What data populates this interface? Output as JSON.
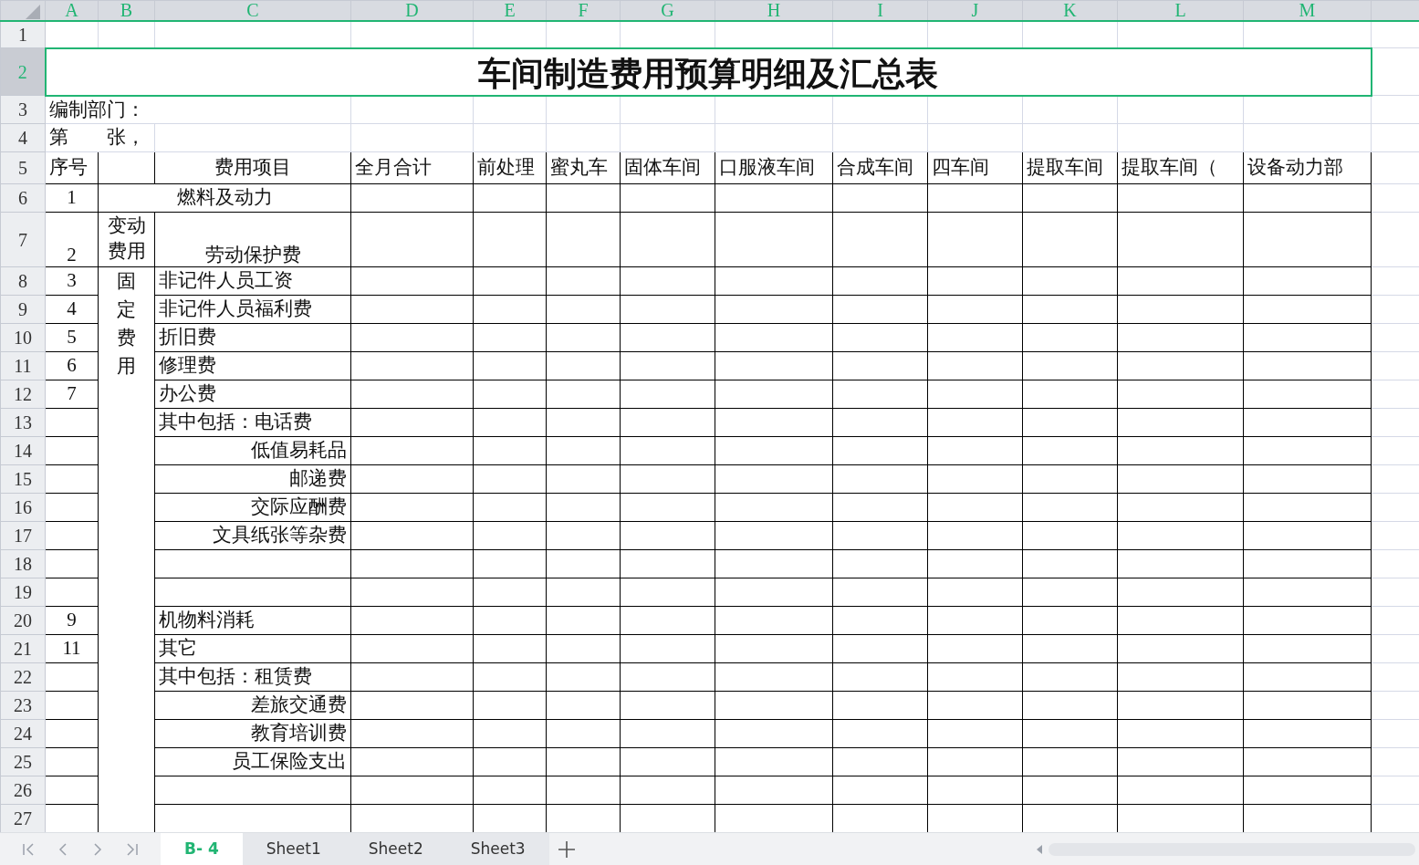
{
  "column_headers": [
    {
      "label": "A",
      "selected": true
    },
    {
      "label": "B",
      "selected": true
    },
    {
      "label": "C",
      "selected": true
    },
    {
      "label": "D",
      "selected": true
    },
    {
      "label": "E",
      "selected": true
    },
    {
      "label": "F",
      "selected": true
    },
    {
      "label": "G",
      "selected": true
    },
    {
      "label": "H",
      "selected": true
    },
    {
      "label": "I",
      "selected": true
    },
    {
      "label": "J",
      "selected": true
    },
    {
      "label": "K",
      "selected": true
    },
    {
      "label": "L",
      "selected": true
    },
    {
      "label": "M",
      "selected": true
    }
  ],
  "row_numbers": [
    {
      "label": "1",
      "selected": false
    },
    {
      "label": "2",
      "selected": true
    },
    {
      "label": "3",
      "selected": false
    },
    {
      "label": "4",
      "selected": false
    },
    {
      "label": "5",
      "selected": false
    },
    {
      "label": "6",
      "selected": false
    },
    {
      "label": "7",
      "selected": false
    },
    {
      "label": "8",
      "selected": false
    },
    {
      "label": "9",
      "selected": false
    },
    {
      "label": "10",
      "selected": false
    },
    {
      "label": "11",
      "selected": false
    },
    {
      "label": "12",
      "selected": false
    },
    {
      "label": "13",
      "selected": false
    },
    {
      "label": "14",
      "selected": false
    },
    {
      "label": "15",
      "selected": false
    },
    {
      "label": "16",
      "selected": false
    },
    {
      "label": "17",
      "selected": false
    },
    {
      "label": "18",
      "selected": false
    },
    {
      "label": "19",
      "selected": false
    },
    {
      "label": "20",
      "selected": false
    },
    {
      "label": "21",
      "selected": false
    },
    {
      "label": "22",
      "selected": false
    },
    {
      "label": "23",
      "selected": false
    },
    {
      "label": "24",
      "selected": false
    },
    {
      "label": "25",
      "selected": false
    },
    {
      "label": "26",
      "selected": false
    },
    {
      "label": "27",
      "selected": false
    }
  ],
  "title": "车间制造费用预算明细及汇总表",
  "department_label": "编制部门：",
  "page_label": "第　　张，",
  "header_row": {
    "seq": "序号",
    "item": "费用项目",
    "columns": [
      "全月合计",
      "前处理",
      "蜜丸车",
      "固体车间",
      "口服液车间",
      "合成车间",
      "四车间",
      "提取车间",
      "提取车间（",
      "设备动力部"
    ]
  },
  "variable_cost_label": "变动费用",
  "fixed_cost_label": "固定费用",
  "rows": [
    {
      "seq": "1",
      "item": "燃料及动力",
      "kind": "main"
    },
    {
      "seq": "2",
      "item": "劳动保护费",
      "kind": "variable"
    },
    {
      "seq": "3",
      "item": "非记件人员工资",
      "kind": "fixed"
    },
    {
      "seq": "4",
      "item": "非记件人员福利费",
      "kind": "fixed"
    },
    {
      "seq": "5",
      "item": "折旧费",
      "kind": "fixed"
    },
    {
      "seq": "6",
      "item": "修理费",
      "kind": "fixed"
    },
    {
      "seq": "7",
      "item": "办公费",
      "kind": "fixed"
    },
    {
      "item": "其中包括：电话费",
      "kind": "fixed"
    },
    {
      "item": "低值易耗品",
      "kind": "sub"
    },
    {
      "item": "邮递费",
      "kind": "sub"
    },
    {
      "item": "交际应酬费",
      "kind": "sub"
    },
    {
      "item": "文具纸张等杂费",
      "kind": "sub"
    },
    {
      "kind": "blank"
    },
    {
      "kind": "blank"
    },
    {
      "seq": "9",
      "item": "机物料消耗",
      "kind": "fixed"
    },
    {
      "seq": "11",
      "item": "其它",
      "kind": "fixed"
    },
    {
      "item": "其中包括：租赁费",
      "kind": "fixed"
    },
    {
      "item": "差旅交通费",
      "kind": "sub"
    },
    {
      "item": "教育培训费",
      "kind": "sub"
    },
    {
      "item": "员工保险支出",
      "kind": "sub"
    },
    {
      "kind": "blank"
    },
    {
      "kind": "blank"
    }
  ],
  "sheet_tabs": [
    {
      "label": "B- 4",
      "selected": true
    },
    {
      "label": "Sheet1",
      "selected": false
    },
    {
      "label": "Sheet2",
      "selected": false
    },
    {
      "label": "Sheet3",
      "selected": false
    }
  ]
}
